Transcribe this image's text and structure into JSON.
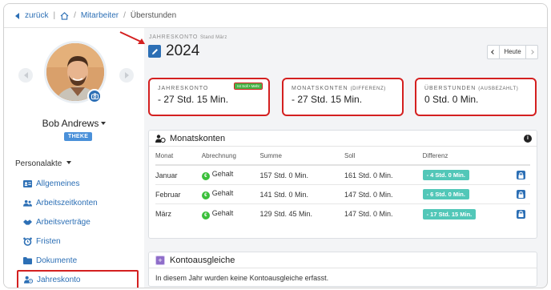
{
  "breadcrumb": {
    "back_label": "zurück",
    "items": [
      "Mitarbeiter",
      "Überstunden"
    ]
  },
  "profile": {
    "name": "Bob Andrews",
    "team_badge": "THEKE"
  },
  "sidebar": {
    "section_title": "Personalakte",
    "items": [
      {
        "label": "Allgemeines",
        "icon": "id-card-icon"
      },
      {
        "label": "Arbeitszeitkonten",
        "icon": "users-icon"
      },
      {
        "label": "Arbeitsverträge",
        "icon": "contract-icon"
      },
      {
        "label": "Fristen",
        "icon": "alarm-clock-icon"
      },
      {
        "label": "Dokumente",
        "icon": "folder-icon"
      },
      {
        "label": "Jahreskonto",
        "icon": "user-clock-icon",
        "active": true
      }
    ]
  },
  "header": {
    "label": "JAHRESKONTO",
    "sublabel": "Stand März",
    "year": "2024",
    "today_button": "Heute"
  },
  "cards": [
    {
      "label": "JAHRESKONTO",
      "label_suffix": "",
      "value": "- 27 Std. 15 Min.",
      "badge": "Ist Soll  • Mehr"
    },
    {
      "label": "MONATSKONTEN",
      "label_suffix": "(DIFFERENZ)",
      "value": "- 27 Std. 15 Min."
    },
    {
      "label": "ÜBERSTUNDEN",
      "label_suffix": "(AUSBEZAHLT)",
      "value": "0 Std. 0 Min."
    }
  ],
  "monthly": {
    "title": "Monatskonten",
    "columns": [
      "Monat",
      "Abrechnung",
      "Summe",
      "Soll",
      "Differenz"
    ],
    "rows": [
      {
        "month": "Januar",
        "billing": "Gehalt",
        "sum": "157 Std. 0 Min.",
        "target": "161 Std. 0 Min.",
        "diff": "- 4 Std. 0 Min."
      },
      {
        "month": "Februar",
        "billing": "Gehalt",
        "sum": "141 Std. 0 Min.",
        "target": "147 Std. 0 Min.",
        "diff": "- 6 Std. 0 Min."
      },
      {
        "month": "März",
        "billing": "Gehalt",
        "sum": "129 Std. 45 Min.",
        "target": "147 Std. 0 Min.",
        "diff": "- 17 Std. 15 Min."
      }
    ]
  },
  "adjustments": {
    "title": "Kontoausgleiche",
    "message": "In diesem Jahr wurden keine Kontoausgleiche erfasst."
  },
  "colors": {
    "accent": "#2c6fb5",
    "highlight": "#d42020",
    "diff_badge": "#52c7b8",
    "salary_dot": "#3bbf3b"
  }
}
